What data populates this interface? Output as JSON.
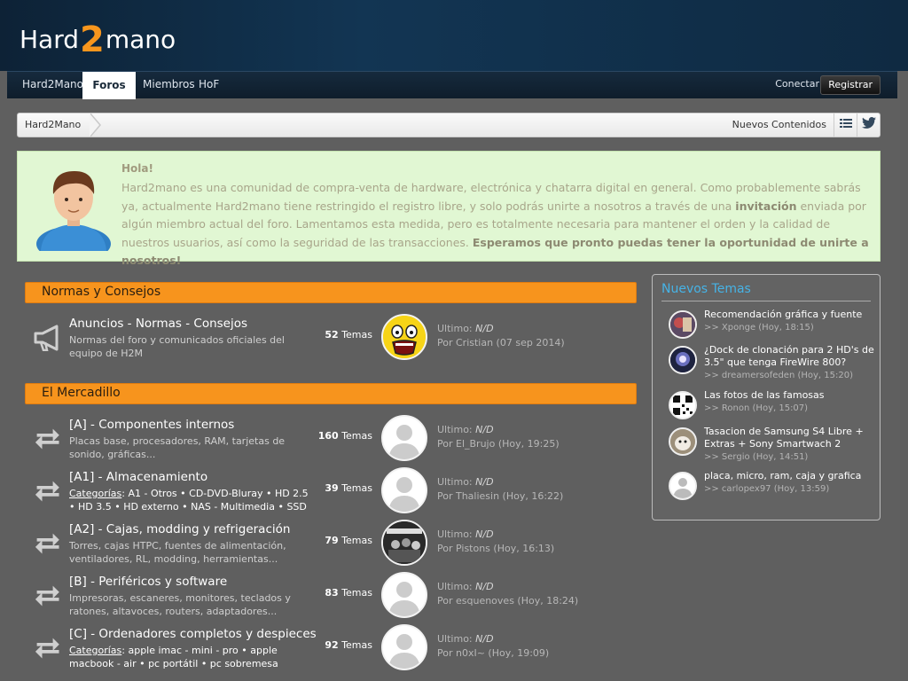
{
  "brand": {
    "prefix": "Hard",
    "two": "2",
    "suffix": "mano"
  },
  "nav": {
    "items": [
      {
        "label": "Hard2Mano"
      },
      {
        "label": "Foros"
      },
      {
        "label": "Miembros"
      },
      {
        "label": "HoF"
      }
    ],
    "conectar": "Conectar",
    "registrar": "Registrar"
  },
  "breadcrumb": {
    "home": "Hard2Mano",
    "nuevos": "Nuevos Contenidos"
  },
  "welcome": {
    "title": "Hola!",
    "text1": "Hard2mano es una comunidad de compra-venta de hardware, electrónica y chatarra digital en general. Como probablemente sabrás ya, actualmente Hard2mano tiene restringido el registro libre, y solo podrás unirte a nosotros a través de una ",
    "bold1": "invitación",
    "text2": " enviada por algún miembro actual del foro. Lamentamos esta medida, pero es totalmente necesaria para mantener el orden y la calidad de nuestros usuarios, así como la seguridad de las transacciones. ",
    "bold2": "Esperamos que pronto puedas tener la oportunidad de unirte a nosotros!"
  },
  "categories": [
    {
      "title": "Normas y Consejos"
    },
    {
      "title": "El Mercadillo"
    }
  ],
  "forums": [
    {
      "title": "Anuncios - Normas - Consejos",
      "desc": "Normas del foro y comunicados oficiales del equipo de H2M",
      "count": "52",
      "count_label": "Temas",
      "last_label": "Ultimo:",
      "last_value": "N/D",
      "by": "Por Cristian (07 sep 2014)"
    },
    {
      "title": "[A] - Componentes internos",
      "desc": "Placas base, procesadores, RAM, tarjetas de sonido, gráficas...",
      "count": "160",
      "count_label": "Temas",
      "last_label": "Ultimo:",
      "last_value": "N/D",
      "by": "Por El_Brujo (Hoy, 19:25)"
    },
    {
      "title": "[A1] - Almacenamiento",
      "cat_label": "Categorías",
      "desc_cats": ": A1 - Otros • CD-DVD-Bluray • HD 2.5 • HD 3.5 • HD externo • NAS - Multimedia • SSD",
      "count": "39",
      "count_label": "Temas",
      "last_label": "Ultimo:",
      "last_value": "N/D",
      "by": "Por Thaliesin (Hoy, 16:22)"
    },
    {
      "title": "[A2] - Cajas, modding y refrigeración",
      "desc": "Torres, cajas HTPC, fuentes de alimentación, ventiladores, RL, modding, herramientas...",
      "count": "79",
      "count_label": "Temas",
      "last_label": "Ultimo:",
      "last_value": "N/D",
      "by": "Por Pistons (Hoy, 16:13)"
    },
    {
      "title": "[B] - Periféricos y software",
      "desc": "Impresoras, escaneres, monitores, teclados y ratones, altavoces, routers, adaptadores...",
      "count": "83",
      "count_label": "Temas",
      "last_label": "Ultimo:",
      "last_value": "N/D",
      "by": "Por esquenoves (Hoy, 18:24)"
    },
    {
      "title": "[C] - Ordenadores completos y despieces",
      "cat_label": "Categorías",
      "desc_cats": ": apple imac - mini - pro • apple macbook - air • pc portátil • pc sobremesa",
      "count": "92",
      "count_label": "Temas",
      "last_label": "Ultimo:",
      "last_value": "N/D",
      "by": "Por n0xI~ (Hoy, 19:09)"
    }
  ],
  "sidebar": {
    "title": "Nuevos Temas",
    "items": [
      {
        "title": "Recomendación gráfica y fuente",
        "meta": ">> Xponge (Hoy, 18:15)"
      },
      {
        "title": "¿Dock de clonación para 2 HD's de 3.5\" que tenga FireWire 800?",
        "meta": ">> dreamersofeden (Hoy, 15:20)"
      },
      {
        "title": "Las fotos de las famosas",
        "meta": ">> Ronon (Hoy, 15:07)"
      },
      {
        "title": "Tasacion de Samsung S4 Libre + Extras + Sony Smartwach 2",
        "meta": ">> Sergio (Hoy, 14:51)"
      },
      {
        "title": "placa, micro, ram, caja y grafica",
        "meta": ">> carlopex97 (Hoy, 13:59)"
      }
    ]
  }
}
